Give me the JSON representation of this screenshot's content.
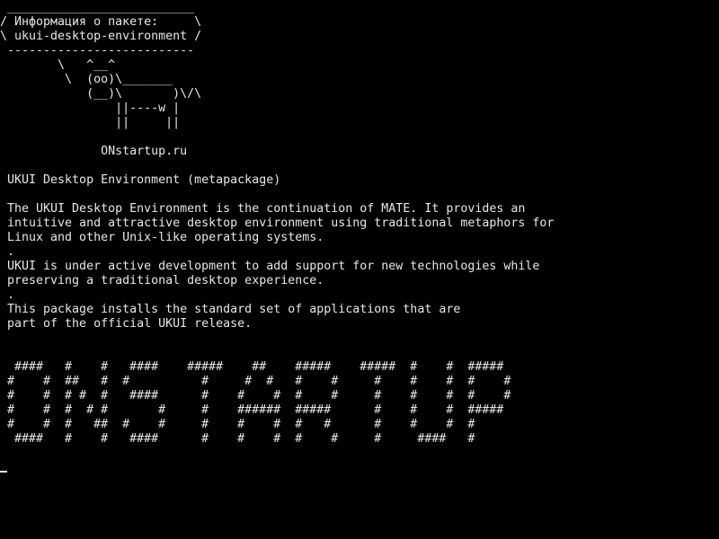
{
  "terminal": {
    "colors": {
      "background": "#000000",
      "foreground": "#e8e8e8"
    },
    "cowsay": " __________________________\n/ Информация о пакете:     \\\n\\ ukui-desktop-environment /\n --------------------------\n        \\   ^__^\n         \\  (oo)\\_______\n            (__)\\       )\\/\\\n                ||----w |\n                ||     ||\n\n              ONstartup.ru",
    "description": " UKUI Desktop Environment (metapackage)\n\n The UKUI Desktop Environment is the continuation of MATE. It provides an\n intuitive and attractive desktop environment using traditional metaphors for\n Linux and other Unix-like operating systems.\n .\n UKUI is under active development to add support for new technologies while\n preserving a traditional desktop experience.\n .\n This package installs the standard set of applications that are\n part of the official UKUI release.",
    "banner": "  ####   #    #   ####    #####    ##    #####    #####  #    #  #####\n #    #  ##   #  #          #     #  #   #    #     #    #    #  #    #\n #    #  # #  #   ####      #    #    #  #    #     #    #    #  #    #\n #    #  #  # #       #     #    ######  #####      #    #    #  #####\n #    #  #   ##  #    #     #    #    #  #   #      #    #    #  #\n  ####   #    #   ####      #    #    #  #    #     #     ####   #"
  }
}
